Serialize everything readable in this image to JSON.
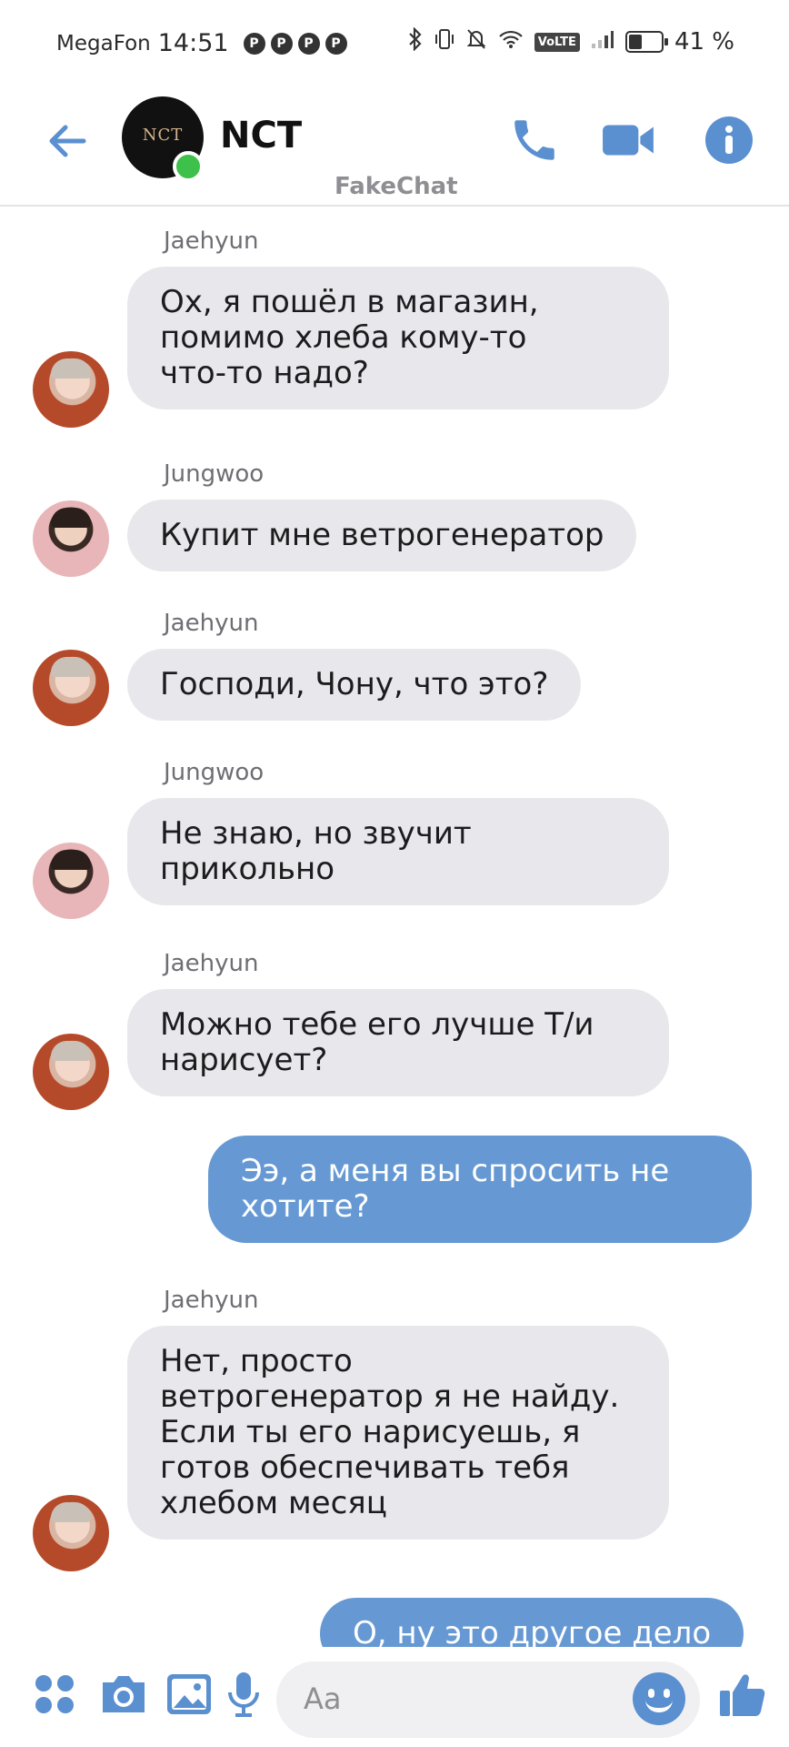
{
  "status_bar": {
    "carrier": "MegaFon",
    "time": "14:51",
    "notification_icons": [
      "P",
      "P",
      "P",
      "P"
    ],
    "volte": "VoLTE",
    "battery_level": 0.41,
    "battery_text": "41 %"
  },
  "header": {
    "group_name": "NCT",
    "group_avatar_text": "NCT",
    "watermark": "FakeChat"
  },
  "messages": [
    {
      "sender": "Jaehyun",
      "text": "Ох, я пошёл в магазин, помимо хлеба кому-то что-то надо?",
      "lines": [
        "Ох, я пошёл в магазин,",
        "помимо хлеба кому-то",
        "что-то надо?"
      ],
      "direction": "incoming"
    },
    {
      "sender": "Jungwoo",
      "text": "Купит мне ветрогенератор",
      "lines": [
        "Купит мне ветрогенератор"
      ],
      "direction": "incoming"
    },
    {
      "sender": "Jaehyun",
      "text": "Господи, Чону, что это?",
      "lines": [
        "Господи, Чону, что это?"
      ],
      "direction": "incoming"
    },
    {
      "sender": "Jungwoo",
      "text": "Не знаю, но звучит прикольно",
      "lines": [
        "Не знаю, но звучит",
        "прикольно"
      ],
      "direction": "incoming"
    },
    {
      "sender": "Jaehyun",
      "text": "Можно тебе его лучше Т/и нарисует?",
      "lines": [
        "Можно тебе его лучше Т/и",
        "нарисует?"
      ],
      "direction": "incoming"
    },
    {
      "sender": "",
      "text": "Ээ, а меня вы спросить не хотите?",
      "lines": [
        "Ээ, а меня вы спросить не",
        "хотите?"
      ],
      "direction": "outgoing"
    },
    {
      "sender": "Jaehyun",
      "text": "Нет, просто ветрогенератор я не найду. Если ты его нарисуешь, я готов обеспечивать тебя хлебом месяц",
      "lines": [
        "Нет, просто",
        "ветрогенератор я не найду.",
        "Если ты его нарисуешь, я",
        "готов обеспечивать тебя",
        "хлебом месяц"
      ],
      "direction": "incoming"
    },
    {
      "sender": "",
      "text": "О, ну это другое дело",
      "lines": [
        "О, ну это другое дело"
      ],
      "direction": "outgoing"
    }
  ],
  "composer": {
    "placeholder": "Aa"
  },
  "colors": {
    "accent": "#5a8fd0",
    "outgoing_bubble": "#6699d3",
    "incoming_bubble": "#e8e8ec",
    "online": "#3ec14a"
  },
  "icons": {
    "back": "back-arrow-icon",
    "call": "phone-icon",
    "video": "video-camera-icon",
    "info": "info-icon",
    "apps": "apps-grid-icon",
    "camera": "camera-icon",
    "gallery": "image-icon",
    "mic": "microphone-icon",
    "emoji": "emoji-icon",
    "like": "thumbs-up-icon"
  }
}
